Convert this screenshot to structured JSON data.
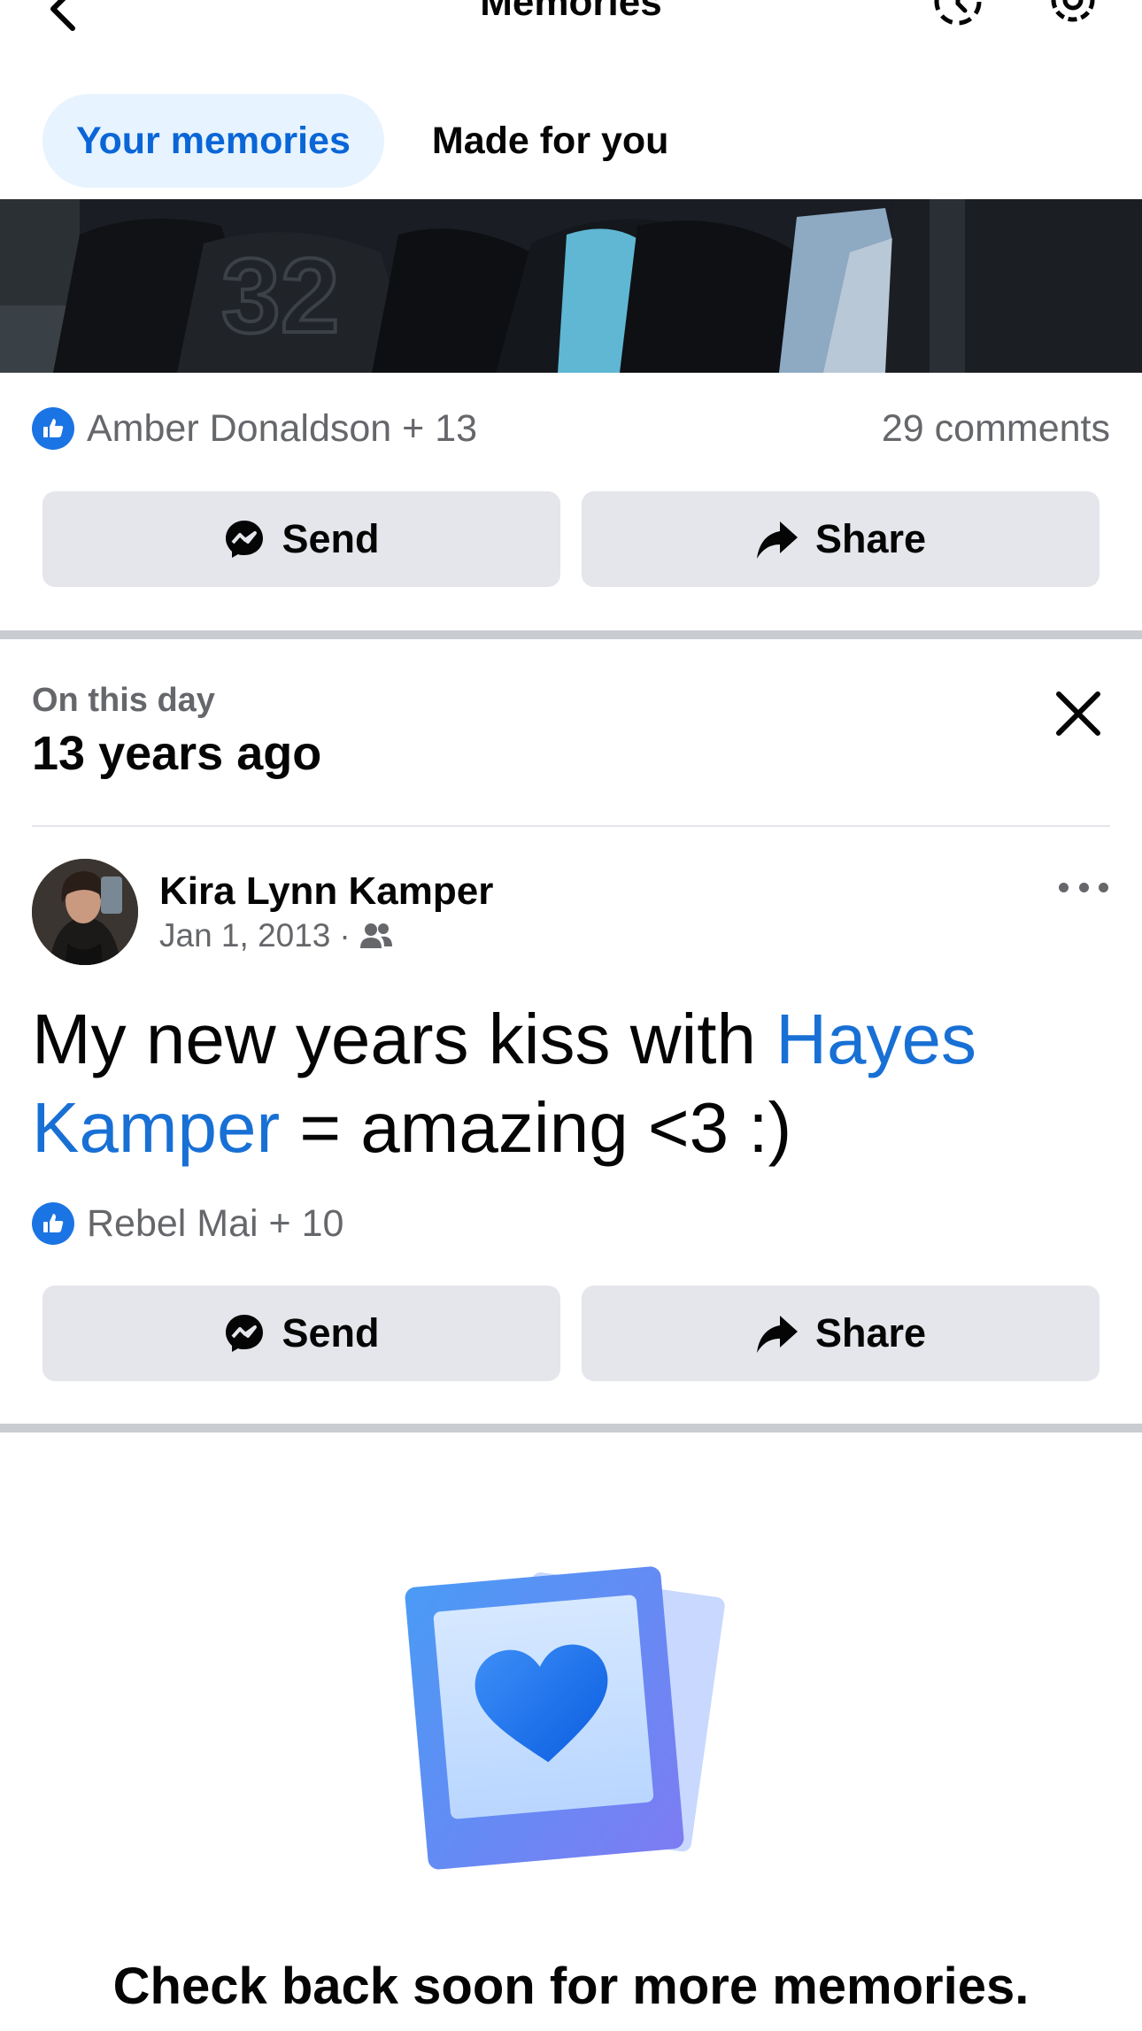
{
  "header": {
    "title": "Memories",
    "back_icon": "chevron-left-icon",
    "history_icon": "history-icon",
    "settings_icon": "gear-icon"
  },
  "tabs": [
    {
      "label": "Your memories",
      "active": true
    },
    {
      "label": "Made for you",
      "active": false
    }
  ],
  "post1": {
    "reactions": "Amber Donaldson + 13",
    "comments": "29 comments",
    "send_label": "Send",
    "share_label": "Share"
  },
  "on_this_day": {
    "label": "On this day",
    "title": "13 years ago"
  },
  "post2": {
    "author": "Kira Lynn Kamper",
    "date": "Jan 1, 2013",
    "separator": "·",
    "audience_icon": "friends-icon",
    "text_before": "My new years kiss with ",
    "mention": "Hayes Kamper",
    "text_after": " = amazing <3 :)",
    "reactions": "Rebel Mai + 10",
    "send_label": "Send",
    "share_label": "Share"
  },
  "footer": {
    "message": "Check back soon for more memories."
  },
  "colors": {
    "accent": "#1b74e4",
    "tab_active_bg": "#e7f3ff",
    "button_bg": "#e4e6eb",
    "secondary_text": "#65676b"
  }
}
